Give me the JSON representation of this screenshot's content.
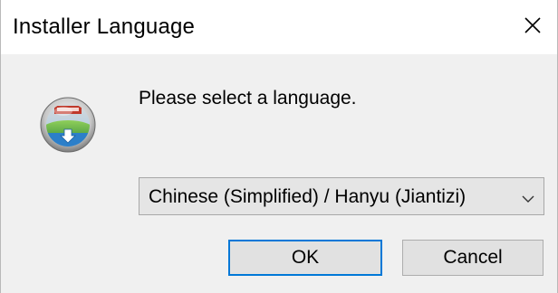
{
  "window": {
    "title": "Installer Language",
    "close_glyph": "×"
  },
  "dialog": {
    "icon": "installer-disc-icon",
    "prompt": "Please select a language.",
    "language_select": {
      "selected": "Chinese (Simplified) / Hanyu (Jiantizi)",
      "arrow_icon": "chevron-down-icon"
    },
    "ok_label": "OK",
    "cancel_label": "Cancel"
  },
  "colors": {
    "dialog_bg": "#f0f0f0",
    "titlebar_bg": "#ffffff",
    "focus_border": "#0078d7",
    "button_bg": "#e1e1e1"
  }
}
